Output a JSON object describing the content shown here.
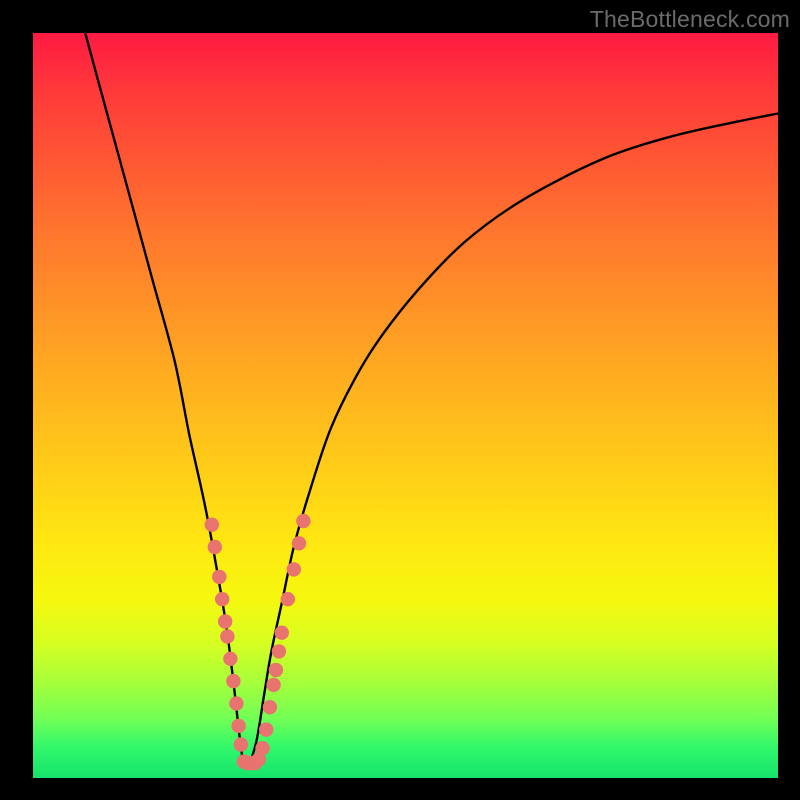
{
  "watermark": "TheBottleneck.com",
  "colors": {
    "frame": "#000000",
    "curve": "#000000",
    "dot": "#e9736e",
    "gradient_stops": [
      "#ff1a43",
      "#ff3a3a",
      "#ff5a33",
      "#ff7a2d",
      "#ff9626",
      "#ffb21f",
      "#ffcc18",
      "#ffe612",
      "#f6f80e",
      "#d6ff22",
      "#a8ff3a",
      "#72ff55",
      "#30f76b",
      "#15e36b"
    ]
  },
  "chart_data": {
    "type": "line",
    "title": "",
    "xlabel": "",
    "ylabel": "",
    "xlim": [
      0,
      100
    ],
    "ylim": [
      0,
      100
    ],
    "series": [
      {
        "name": "bottleneck-curve",
        "x": [
          7,
          10,
          13,
          16,
          19,
          21,
          23,
          24.5,
          26,
          27,
          27.8,
          28.3,
          29,
          30,
          31,
          32,
          33.5,
          35,
          37,
          40,
          44,
          48,
          53,
          58,
          64,
          71,
          78,
          86,
          94,
          100
        ],
        "y": [
          100,
          89,
          78,
          67,
          56,
          46,
          37,
          29,
          20,
          12,
          5,
          2,
          2,
          5,
          11,
          17,
          24,
          31,
          38,
          47,
          55,
          61,
          67,
          72,
          76.5,
          80.5,
          83.7,
          86.2,
          88,
          89.2
        ]
      }
    ],
    "scatter_points": {
      "name": "highlighted-samples",
      "points": [
        {
          "x": 24.0,
          "y": 34
        },
        {
          "x": 24.4,
          "y": 31
        },
        {
          "x": 25.0,
          "y": 27
        },
        {
          "x": 25.4,
          "y": 24
        },
        {
          "x": 25.8,
          "y": 21
        },
        {
          "x": 26.1,
          "y": 19
        },
        {
          "x": 26.5,
          "y": 16
        },
        {
          "x": 26.9,
          "y": 13
        },
        {
          "x": 27.3,
          "y": 10
        },
        {
          "x": 27.6,
          "y": 7
        },
        {
          "x": 27.9,
          "y": 4.5
        },
        {
          "x": 28.3,
          "y": 2.2
        },
        {
          "x": 28.8,
          "y": 2
        },
        {
          "x": 29.3,
          "y": 2
        },
        {
          "x": 29.8,
          "y": 2
        },
        {
          "x": 30.3,
          "y": 2.5
        },
        {
          "x": 30.8,
          "y": 4
        },
        {
          "x": 31.3,
          "y": 6.5
        },
        {
          "x": 31.8,
          "y": 9.5
        },
        {
          "x": 32.3,
          "y": 12.5
        },
        {
          "x": 32.6,
          "y": 14.5
        },
        {
          "x": 33.0,
          "y": 17
        },
        {
          "x": 33.4,
          "y": 19.5
        },
        {
          "x": 34.2,
          "y": 24
        },
        {
          "x": 35.0,
          "y": 28
        },
        {
          "x": 35.7,
          "y": 31.5
        },
        {
          "x": 36.3,
          "y": 34.5
        }
      ]
    }
  }
}
